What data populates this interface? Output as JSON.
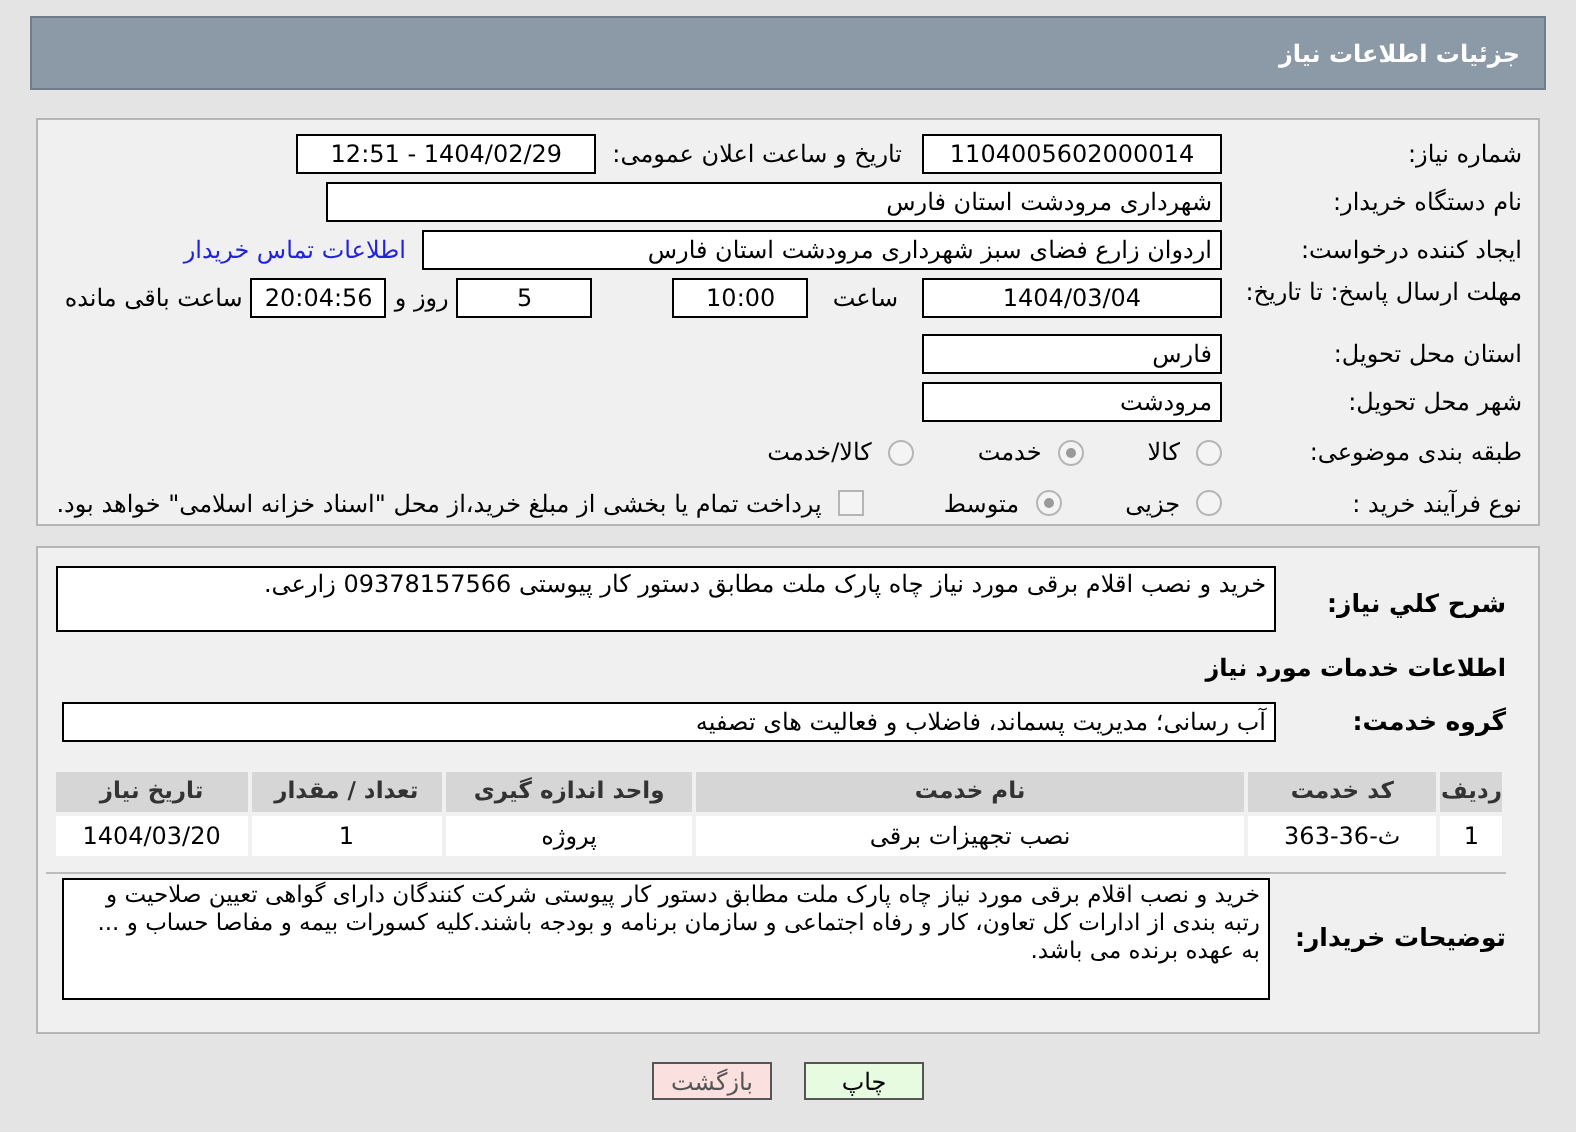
{
  "header": {
    "title": "جزئیات اطلاعات نیاز"
  },
  "need_number": {
    "label": "شماره نیاز:",
    "value": "1104005602000014"
  },
  "announce": {
    "label": "تاریخ و ساعت اعلان عمومی:",
    "value": "1404/02/29 - 12:51"
  },
  "buyer": {
    "label": "نام دستگاه خریدار:",
    "value": "شهرداری مرودشت استان فارس"
  },
  "requester": {
    "label": "ایجاد کننده درخواست:",
    "value": "اردوان زارع فضای سبز شهرداری مرودشت استان فارس",
    "link": "اطلاعات تماس خریدار"
  },
  "deadline": {
    "label": "مهلت ارسال پاسخ: تا تاریخ:",
    "date": "1404/03/04",
    "time_label": "ساعت",
    "time": "10:00",
    "days": "5",
    "days_label": "روز و",
    "remaining": "20:04:56",
    "remaining_label": "ساعت باقی مانده"
  },
  "province": {
    "label": "استان محل تحویل:",
    "value": "فارس"
  },
  "city": {
    "label": "شهر محل تحویل:",
    "value": "مرودشت"
  },
  "category": {
    "label": "طبقه بندی موضوعی:",
    "options": [
      {
        "label": "کالا",
        "selected": false
      },
      {
        "label": "خدمت",
        "selected": true
      },
      {
        "label": "کالا/خدمت",
        "selected": false
      }
    ]
  },
  "process": {
    "label": "نوع فرآیند خرید :",
    "options": [
      {
        "label": "جزیی",
        "selected": false
      },
      {
        "label": "متوسط",
        "selected": true
      }
    ],
    "payment": {
      "label": "پرداخت تمام یا بخشی از مبلغ خرید،از محل \"اسناد خزانه اسلامی\" خواهد بود.",
      "checked": false
    }
  },
  "summary": {
    "label": "شرح کلي نياز:",
    "value": "خرید و نصب اقلام برقی مورد نیاز چاه پارک ملت مطابق دستور کار پیوستی 09378157566 زارعی."
  },
  "services_title": "اطلاعات خدمات مورد نیاز",
  "service_group": {
    "label": "گروه خدمت:",
    "value": "آب رسانی؛ مدیریت پسماند، فاضلاب و فعالیت های تصفیه"
  },
  "table": {
    "columns": [
      "ردیف",
      "کد خدمت",
      "نام خدمت",
      "واحد اندازه گیری",
      "تعداد / مقدار",
      "تاریخ نیاز"
    ],
    "rows": [
      [
        "1",
        "ث-36-363",
        "نصب تجهیزات برقی",
        "پروژه",
        "1",
        "1404/03/20"
      ]
    ]
  },
  "notes": {
    "label": "توضیحات خریدار:",
    "value": "خرید و نصب اقلام برقی مورد نیاز چاه پارک ملت مطابق دستور کار پیوستی شرکت کنندگان  دارای گواهی تعیین صلاحیت و رتبه بندی از ادارات کل تعاون، کار و رفاه اجتماعی و سازمان برنامه و بودجه باشند.کلیه کسورات بیمه و مفاصا حساب و ... به عهده برنده می باشد."
  },
  "buttons": [
    {
      "label": "چاپ",
      "kind": "print"
    },
    {
      "label": "بازگشت",
      "kind": "back"
    }
  ]
}
